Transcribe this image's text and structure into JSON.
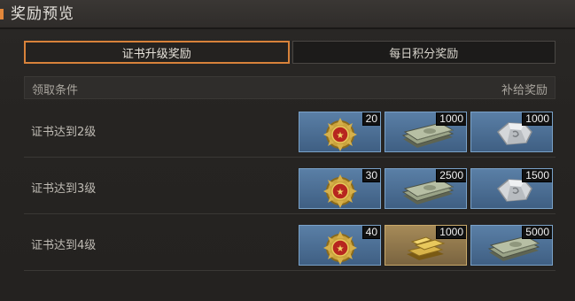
{
  "header": {
    "title": "奖励预览"
  },
  "tabs": [
    {
      "label": "证书升级奖励",
      "active": true
    },
    {
      "label": "每日积分奖励",
      "active": false
    }
  ],
  "columns": {
    "condition": "领取条件",
    "reward": "补给奖励"
  },
  "colors": {
    "accent": "#e3873a",
    "reward_blue": "#4a6d94",
    "reward_gold": "#9a7f4f"
  },
  "rows": [
    {
      "condition": "证书达到2级",
      "rewards": [
        {
          "icon": "medal-icon",
          "count": "20",
          "frame": "blue"
        },
        {
          "icon": "cash-stack-icon",
          "count": "1000",
          "frame": "blue"
        },
        {
          "icon": "silver-ore-icon",
          "count": "1000",
          "frame": "blue"
        }
      ]
    },
    {
      "condition": "证书达到3级",
      "rewards": [
        {
          "icon": "medal-icon",
          "count": "30",
          "frame": "blue"
        },
        {
          "icon": "cash-stack-icon",
          "count": "2500",
          "frame": "blue"
        },
        {
          "icon": "silver-ore-icon",
          "count": "1500",
          "frame": "blue"
        }
      ]
    },
    {
      "condition": "证书达到4级",
      "rewards": [
        {
          "icon": "medal-icon",
          "count": "40",
          "frame": "blue"
        },
        {
          "icon": "gold-bar-icon",
          "count": "1000",
          "frame": "gold"
        },
        {
          "icon": "cash-stack-icon",
          "count": "5000",
          "frame": "blue"
        }
      ]
    }
  ]
}
